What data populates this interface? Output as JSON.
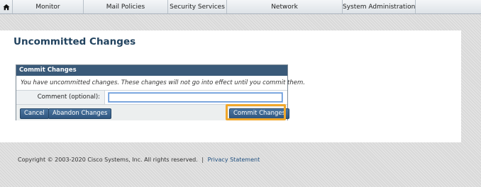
{
  "nav": {
    "home_icon": "home-icon",
    "items": [
      {
        "label": "Monitor"
      },
      {
        "label": "Mail Policies"
      },
      {
        "label": "Security Services"
      },
      {
        "label": "Network"
      },
      {
        "label": "System Administration"
      }
    ]
  },
  "page": {
    "title": "Uncommitted Changes"
  },
  "dialog": {
    "header": "Commit Changes",
    "message": "You have uncommitted changes. These changes will not go into effect until you commit them.",
    "comment_label": "Comment (optional):",
    "comment_value": "",
    "cancel_label": "Cancel",
    "abandon_label": "Abandon Changes",
    "commit_label": "Commit Changes"
  },
  "footer": {
    "copyright": "Copyright © 2003-2020 Cisco Systems, Inc. All rights reserved.",
    "separator": "|",
    "privacy_link": "Privacy Statement"
  },
  "colors": {
    "header_bg": "#3a5a79",
    "title_color": "#22435f",
    "button_bg": "#2f5680",
    "highlight": "#f0a72a"
  }
}
